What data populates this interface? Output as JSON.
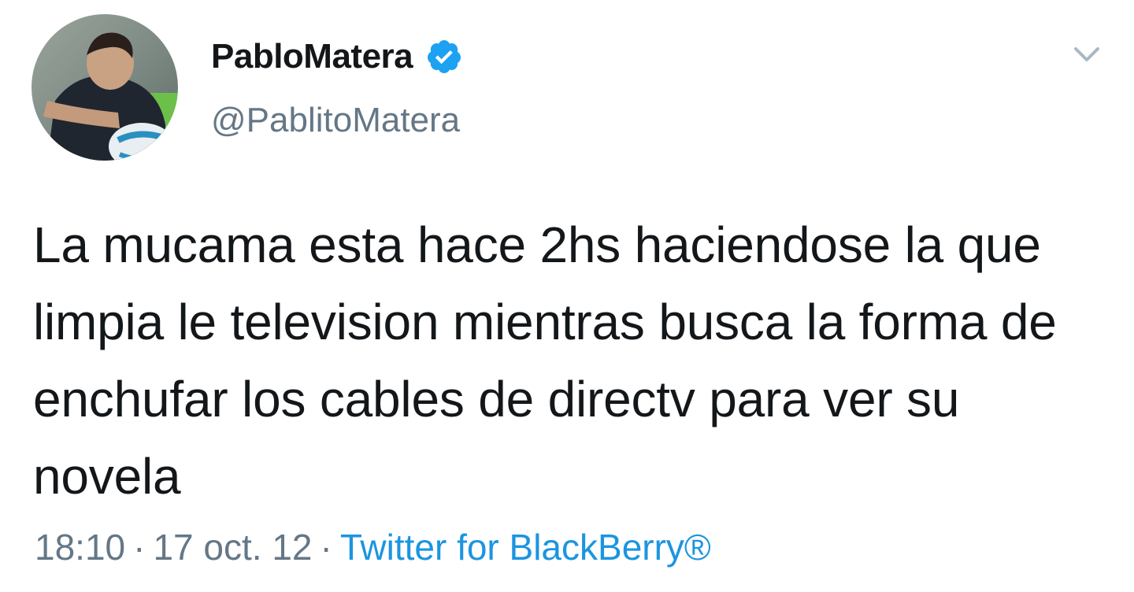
{
  "author": {
    "display_name": "PabloMatera",
    "handle": "@PablitoMatera",
    "verified": true,
    "avatar_icon": "profile-photo-rugby-player"
  },
  "tweet": {
    "text": "La mucama esta hace 2hs haciendose la que limpia le television mientras busca la forma de enchufar los cables de directv para ver su novela"
  },
  "meta": {
    "time": "18:10",
    "separator": "·",
    "date": "17 oct. 12",
    "source": "Twitter for BlackBerry®"
  },
  "colors": {
    "text": "#14171a",
    "secondary": "#657786",
    "link": "#1b95e0",
    "verified_badge": "#1da1f2"
  },
  "icons": {
    "verified": "verified-badge-icon",
    "menu": "chevron-down-icon"
  }
}
